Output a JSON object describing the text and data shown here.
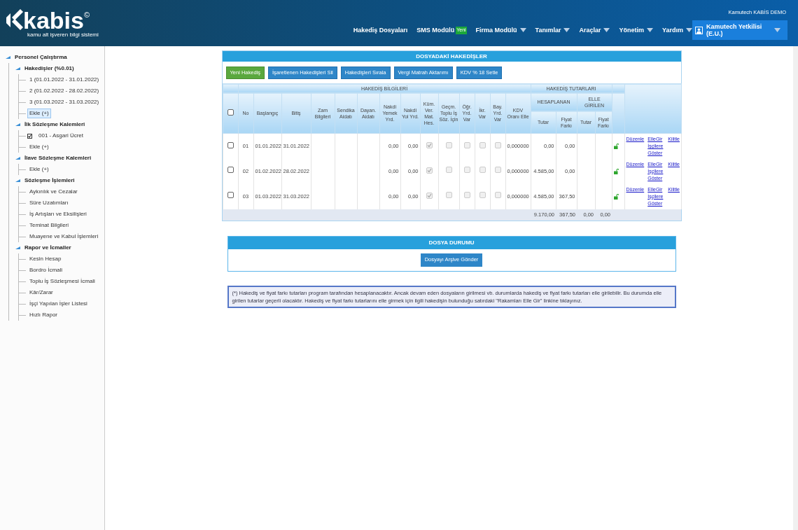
{
  "header": {
    "logo_text": "kabis",
    "logo_mark": "©",
    "logo_subtitle": "kamu alt işveren bilgi sistemi",
    "company": "Kamutech KABİS DEMO",
    "nav": [
      {
        "label": "Hakediş Dosyaları",
        "dropdown": false
      },
      {
        "label": "SMS Modülü",
        "badge": "Yeni",
        "dropdown": false
      },
      {
        "label": "Firma Modülü",
        "dropdown": true
      },
      {
        "label": "Tanımlar",
        "dropdown": true
      },
      {
        "label": "Araçlar",
        "dropdown": true
      },
      {
        "label": "Yönetim",
        "dropdown": true
      },
      {
        "label": "Yardım",
        "dropdown": true
      }
    ],
    "user": {
      "name": "Kamutech Yetkilisi (E.U.)"
    }
  },
  "sidebar": {
    "tree": [
      {
        "label": "Personel Çalıştırma",
        "expanded": true,
        "children": [
          {
            "label": "Hakedişler (%0.01)",
            "expanded": true,
            "children": [
              {
                "label": "1 (01.01.2022 - 31.01.2022)",
                "selected": false
              },
              {
                "label": "2 (01.02.2022 - 28.02.2022)",
                "selected": false
              },
              {
                "label": "3 (01.03.2022 - 31.03.2022)",
                "selected": false
              },
              {
                "label": "Ekle (+)",
                "selected": true
              }
            ]
          },
          {
            "label": "İlk Sözleşme Kalemleri",
            "expanded": true,
            "children": [
              {
                "label": "001 - Asgari Ücret",
                "selected": false,
                "checked": true
              },
              {
                "label": "Ekle (+)",
                "selected": false
              }
            ]
          },
          {
            "label": "İlave Sözleşme Kalemleri",
            "expanded": true,
            "children": [
              {
                "label": "Ekle (+)",
                "selected": false
              }
            ]
          },
          {
            "label": "Sözleşme İşlemleri",
            "expanded": true,
            "children": [
              {
                "label": "Aykırılık ve Cezalar",
                "selected": false
              },
              {
                "label": "Süre Uzatımları",
                "selected": false
              },
              {
                "label": "İş Artışları ve Eksilişleri",
                "selected": false
              },
              {
                "label": "Teminat Bilgileri",
                "selected": false
              },
              {
                "label": "Muayene ve Kabul İşlemleri",
                "selected": false
              }
            ]
          },
          {
            "label": "Rapor ve İcmaller",
            "expanded": true,
            "children": [
              {
                "label": "Kesin Hesap",
                "selected": false
              },
              {
                "label": "Bordro İcmali",
                "selected": false
              },
              {
                "label": "Toplu İş Sözleşmesi İcmali",
                "selected": false
              },
              {
                "label": "Kâr/Zarar",
                "selected": false
              },
              {
                "label": "İşçi Yapılan İşler Listesi",
                "selected": false
              },
              {
                "label": "Hızlı Rapor",
                "selected": false
              }
            ]
          }
        ]
      }
    ]
  },
  "hakedisler": {
    "title": "DOSYADAKİ HAKEDİŞLER",
    "buttons": [
      {
        "label": "Yeni Hakediş",
        "kind": "primary"
      },
      {
        "label": "İşaretlenen Hakedişleri Sil",
        "kind": "default"
      },
      {
        "label": "Hakedişleri Sırala",
        "kind": "default"
      },
      {
        "label": "Vergi Matrah Aktarımı",
        "kind": "default"
      },
      {
        "label": "KDV % 18 Setle",
        "kind": "default"
      }
    ],
    "group_headers": [
      "HAKEDİŞ BİLGİLERİ",
      "HAKEDİŞ TUTARLARI"
    ],
    "columns": [
      "No",
      "Başlangıç",
      "Bitiş",
      "Zam Bilgileri",
      "Sendika Aidatı",
      "Dayan. Aidatı",
      "Nakdi Yemek Yrd.",
      "Nakdi Yol Yrd.",
      "Küm. Ver. Mat. Hes.",
      "Geçm. Toplu İş Söz. İçin",
      "Öğr. Yrd. Var",
      "İkr. Var",
      "Bay. Yrd. Var",
      "KDV Oranı Elle"
    ],
    "amount_groups": [
      {
        "label": "HESAPLANAN",
        "columns": [
          "Tutar",
          "Fiyat Farkı"
        ]
      },
      {
        "label": "ELLE GİRİLEN",
        "columns": [
          "Tutar",
          "Fiyat Farkı"
        ]
      }
    ],
    "select_all": {
      "checked": false
    },
    "rows": [
      {
        "checked": false,
        "no": "01",
        "start": "01.01.2022",
        "end": "31.01.2022",
        "yemek": "0,00",
        "yol": "0,00",
        "kum": true,
        "gecm": false,
        "ogr": false,
        "ikr": false,
        "bay": false,
        "kdv": "0,000000",
        "tutar": "0,00",
        "fiyat_farki": "0,00",
        "locked": false,
        "links": [
          "Düzenle",
          "ElleGir",
          "İşçilere Göster",
          "Kilitle"
        ]
      },
      {
        "checked": false,
        "no": "02",
        "start": "01.02.2022",
        "end": "28.02.2022",
        "yemek": "0,00",
        "yol": "0,00",
        "kum": true,
        "gecm": false,
        "ogr": false,
        "ikr": false,
        "bay": false,
        "kdv": "0,000000",
        "tutar": "4.585,00",
        "fiyat_farki": "0,00",
        "locked": false,
        "links": [
          "Düzenle",
          "ElleGir",
          "İşçilere Göster",
          "Kilitle"
        ]
      },
      {
        "checked": false,
        "no": "03",
        "start": "01.03.2022",
        "end": "31.03.2022",
        "yemek": "0,00",
        "yol": "0,00",
        "kum": true,
        "gecm": false,
        "ogr": false,
        "ikr": false,
        "bay": false,
        "kdv": "0,000000",
        "tutar": "4.585,00",
        "fiyat_farki": "367,50",
        "locked": false,
        "links": [
          "Düzenle",
          "ElleGir",
          "İşçilere Göster",
          "Kilitle"
        ]
      }
    ],
    "totals": [
      "9.170,00",
      "367,50",
      "0,00",
      "0,00"
    ]
  },
  "dosya_durumu": {
    "title": "DOSYA DURUMU",
    "button": "Dosyayı Arşive Gönder"
  },
  "note": "(*) Hakediş ve fiyat farkı tutarları program tarafından hesaplanacaktır. Ancak devam eden dosyaların girilmesi vb. durumlarda hakediş ve fiyat farkı tutarları elle girilebilir. Bu durumda elle girilen tutarlar geçerli olacaktır. Hakediş ve fiyat farkı tutarlarını elle girmek için ilgili hakedişin bulunduğu satırdaki \"Rakamları Elle Gir\" linkine tıklayınız."
}
